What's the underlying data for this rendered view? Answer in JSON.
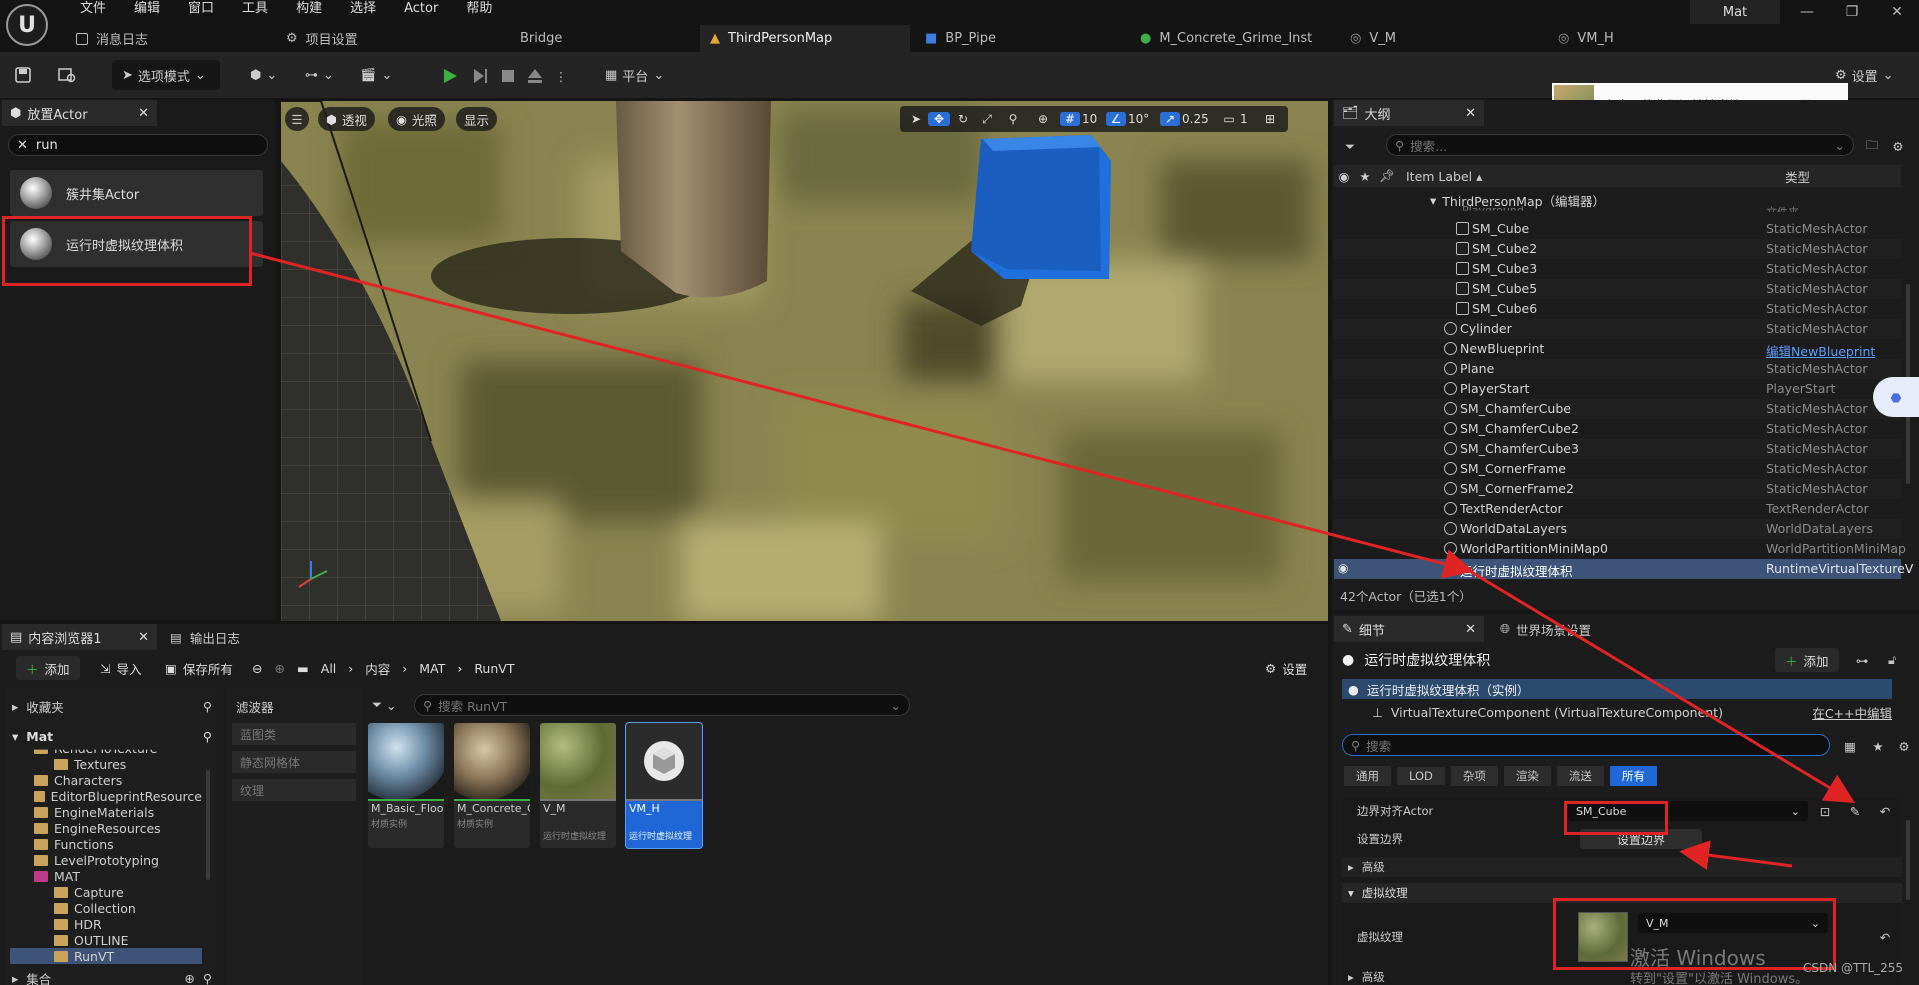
{
  "menubar": {
    "items": [
      "文件",
      "编辑",
      "窗口",
      "工具",
      "构建",
      "选择",
      "Actor",
      "帮助"
    ],
    "project": "Mat"
  },
  "tabs": [
    {
      "label": "消息日志",
      "icon": "message-log-icon"
    },
    {
      "label": "项目设置",
      "icon": "gear-icon"
    },
    {
      "label": "Bridge",
      "icon": ""
    },
    {
      "label": "ThirdPersonMap",
      "icon": "map-icon",
      "active": true
    },
    {
      "label": "BP_Pipe",
      "icon": "blueprint-icon"
    },
    {
      "label": "M_Concrete_Grime_Inst",
      "icon": "material-icon"
    },
    {
      "label": "V_M",
      "icon": "virtual-texture-icon"
    },
    {
      "label": "VM_H",
      "icon": "virtual-texture-icon"
    }
  ],
  "toolbar": {
    "mode": "选项模式",
    "platform": "平台",
    "settings": "设置"
  },
  "place_actors": {
    "tab": "放置Actor",
    "search": "run",
    "items": [
      "簇井集Actor",
      "运行时虚拟纹理体积"
    ]
  },
  "viewport": {
    "buttons": [
      "透视",
      "光照",
      "显示"
    ],
    "grid": "10",
    "angle": "10°",
    "scale": "0.25",
    "cam": "1"
  },
  "notification": {
    "text": "在音目的背影间悄悄走掉"
  },
  "outliner": {
    "tab": "大纲",
    "search_placeholder": "搜索...",
    "col_label": "Item Label ▴",
    "col_type": "类型",
    "root": "ThirdPersonMap（编辑器）",
    "clipped": {
      "name": "Playground",
      "type": "文件夹"
    },
    "rows": [
      {
        "name": "SM_Cube",
        "type": "StaticMeshActor",
        "indent": 1
      },
      {
        "name": "SM_Cube2",
        "type": "StaticMeshActor",
        "indent": 1
      },
      {
        "name": "SM_Cube3",
        "type": "StaticMeshActor",
        "indent": 1
      },
      {
        "name": "SM_Cube5",
        "type": "StaticMeshActor",
        "indent": 1
      },
      {
        "name": "SM_Cube6",
        "type": "StaticMeshActor",
        "indent": 1
      },
      {
        "name": "Cylinder",
        "type": "StaticMeshActor",
        "indent": 0
      },
      {
        "name": "NewBlueprint",
        "type": "编辑NewBlueprint",
        "indent": 0,
        "link": true
      },
      {
        "name": "Plane",
        "type": "StaticMeshActor",
        "indent": 0
      },
      {
        "name": "PlayerStart",
        "type": "PlayerStart",
        "indent": 0
      },
      {
        "name": "SM_ChamferCube",
        "type": "StaticMeshActor",
        "indent": 0
      },
      {
        "name": "SM_ChamferCube2",
        "type": "StaticMeshActor",
        "indent": 0
      },
      {
        "name": "SM_ChamferCube3",
        "type": "StaticMeshActor",
        "indent": 0
      },
      {
        "name": "SM_CornerFrame",
        "type": "StaticMeshActor",
        "indent": 0
      },
      {
        "name": "SM_CornerFrame2",
        "type": "StaticMeshActor",
        "indent": 0
      },
      {
        "name": "TextRenderActor",
        "type": "TextRenderActor",
        "indent": 0
      },
      {
        "name": "WorldDataLayers",
        "type": "WorldDataLayers",
        "indent": 0
      },
      {
        "name": "WorldPartitionMiniMap0",
        "type": "WorldPartitionMiniMap",
        "indent": 0
      },
      {
        "name": "运行时虚拟纹理体积",
        "type": "RuntimeVirtualTextureV",
        "indent": 0,
        "selected": true
      }
    ],
    "status": "42个Actor（已选1个）"
  },
  "details": {
    "tab": "细节",
    "tab2": "世界场景设置",
    "title": "运行时虚拟纹理体积",
    "add": "添加",
    "instance": "运行时虚拟纹理体积（实例）",
    "component": "VirtualTextureComponent (VirtualTextureComponent)",
    "cpp_link": "在C++中编辑",
    "search_placeholder": "搜索",
    "filters": [
      "通用",
      "LOD",
      "杂项",
      "渲染",
      "流送",
      "所有"
    ],
    "bounds_label": "边界对齐Actor",
    "bounds_value": "SM_Cube",
    "setbounds_label": "设置边界",
    "setbounds_button": "设置边界",
    "advanced": "高级",
    "vt_section": "虚拟纹理",
    "vt_label": "虚拟纹理",
    "vt_value": "V_M",
    "advanced2": "高级"
  },
  "content_browser": {
    "tab": "内容浏览器1",
    "tab2": "输出日志",
    "add": "添加",
    "import": "导入",
    "saveall": "保存所有",
    "path": [
      "All",
      "内容",
      "MAT",
      "RunVT"
    ],
    "settings": "设置",
    "favorites": "收藏夹",
    "project": "Mat",
    "tree": [
      {
        "name": "RenderToTexture",
        "level": 1,
        "clipped": true
      },
      {
        "name": "Textures",
        "level": 2
      },
      {
        "name": "Characters",
        "level": 1
      },
      {
        "name": "EditorBlueprintResource",
        "level": 1
      },
      {
        "name": "EngineMaterials",
        "level": 1
      },
      {
        "name": "EngineResources",
        "level": 1
      },
      {
        "name": "Functions",
        "level": 1
      },
      {
        "name": "LevelPrototyping",
        "level": 1
      },
      {
        "name": "MAT",
        "level": 1,
        "open": true
      },
      {
        "name": "Capture",
        "level": 2
      },
      {
        "name": "Collection",
        "level": 2
      },
      {
        "name": "HDR",
        "level": 2
      },
      {
        "name": "OUTLINE",
        "level": 2
      },
      {
        "name": "RunVT",
        "level": 2,
        "selected": true
      }
    ],
    "collections": "集合",
    "filters_title": "滤波器",
    "filters": [
      "蓝图类",
      "静态网格体",
      "纹理"
    ],
    "search_placeholder": "搜索 RunVT",
    "assets": [
      {
        "name": "M_Basic_Floor_Inst",
        "type": "材质实例"
      },
      {
        "name": "M_Concrete_Grime_Inst",
        "type": "材质实例"
      },
      {
        "name": "V_M",
        "type": "运行时虚拟纹理"
      },
      {
        "name": "VM_H",
        "type": "运行时虚拟纹理",
        "selected": true
      }
    ]
  },
  "watermark": {
    "line1": "激活 Windows",
    "line2": "转到\"设置\"以激活 Windows。",
    "credit": "CSDN @TTL_255"
  }
}
